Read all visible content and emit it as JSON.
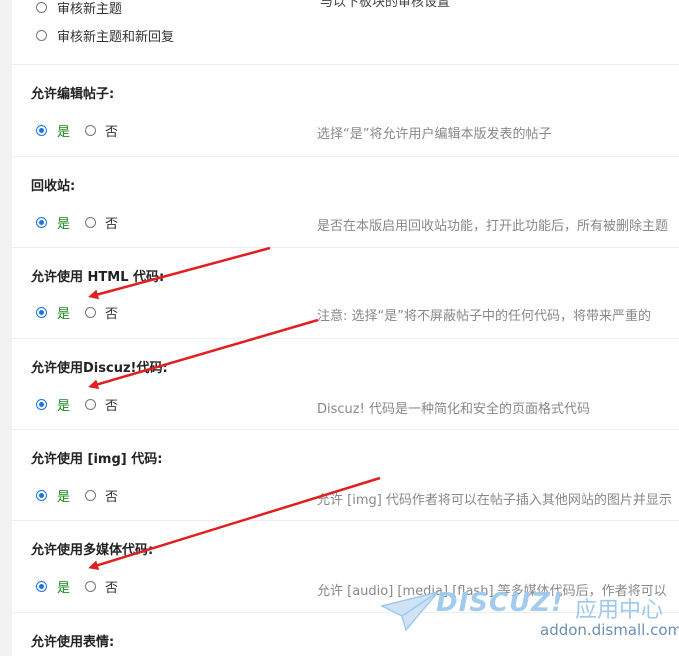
{
  "moderation_options": [
    {
      "label": "审核新主题",
      "selected": false
    },
    {
      "label": "审核新主题和新回复",
      "selected": false
    }
  ],
  "moderation_desc_partial": "与以下板块的审核设置",
  "settings": [
    {
      "title": "允许编辑帖子:",
      "yes": "是",
      "no": "否",
      "value": "yes",
      "desc": "选择“是”将允许用户编辑本版发表的帖子"
    },
    {
      "title": "回收站:",
      "yes": "是",
      "no": "否",
      "value": "yes",
      "desc": "是否在本版启用回收站功能，打开此功能后，所有被删除主题"
    },
    {
      "title": "允许使用 HTML 代码:",
      "yes": "是",
      "no": "否",
      "value": "yes",
      "desc": "注意: 选择“是”将不屏蔽帖子中的任何代码，将带来严重的"
    },
    {
      "title": "允许使用Discuz!代码:",
      "yes": "是",
      "no": "否",
      "value": "yes",
      "desc": "Discuz! 代码是一种简化和安全的页面格式代码"
    },
    {
      "title": "允许使用 [img] 代码:",
      "yes": "是",
      "no": "否",
      "value": "yes",
      "desc": "允许 [img] 代码作者将可以在帖子插入其他网站的图片并显示"
    },
    {
      "title": "允许使用多媒体代码:",
      "yes": "是",
      "no": "否",
      "value": "yes",
      "desc": "允许 [audio] [media] [flash] 等多媒体代码后，作者将可以"
    },
    {
      "title": "允许使用表情:",
      "yes": "",
      "no": "",
      "value": "",
      "desc": ""
    }
  ],
  "watermark": {
    "logo_text": "DISCUZ!",
    "cn_text": "应用中心",
    "url_text": "addon.dismall.com"
  },
  "colors": {
    "radio_selected": "#1a73e8",
    "yes_label": "#1a8a1a",
    "arrow": "#e02020",
    "desc": "#888888"
  }
}
